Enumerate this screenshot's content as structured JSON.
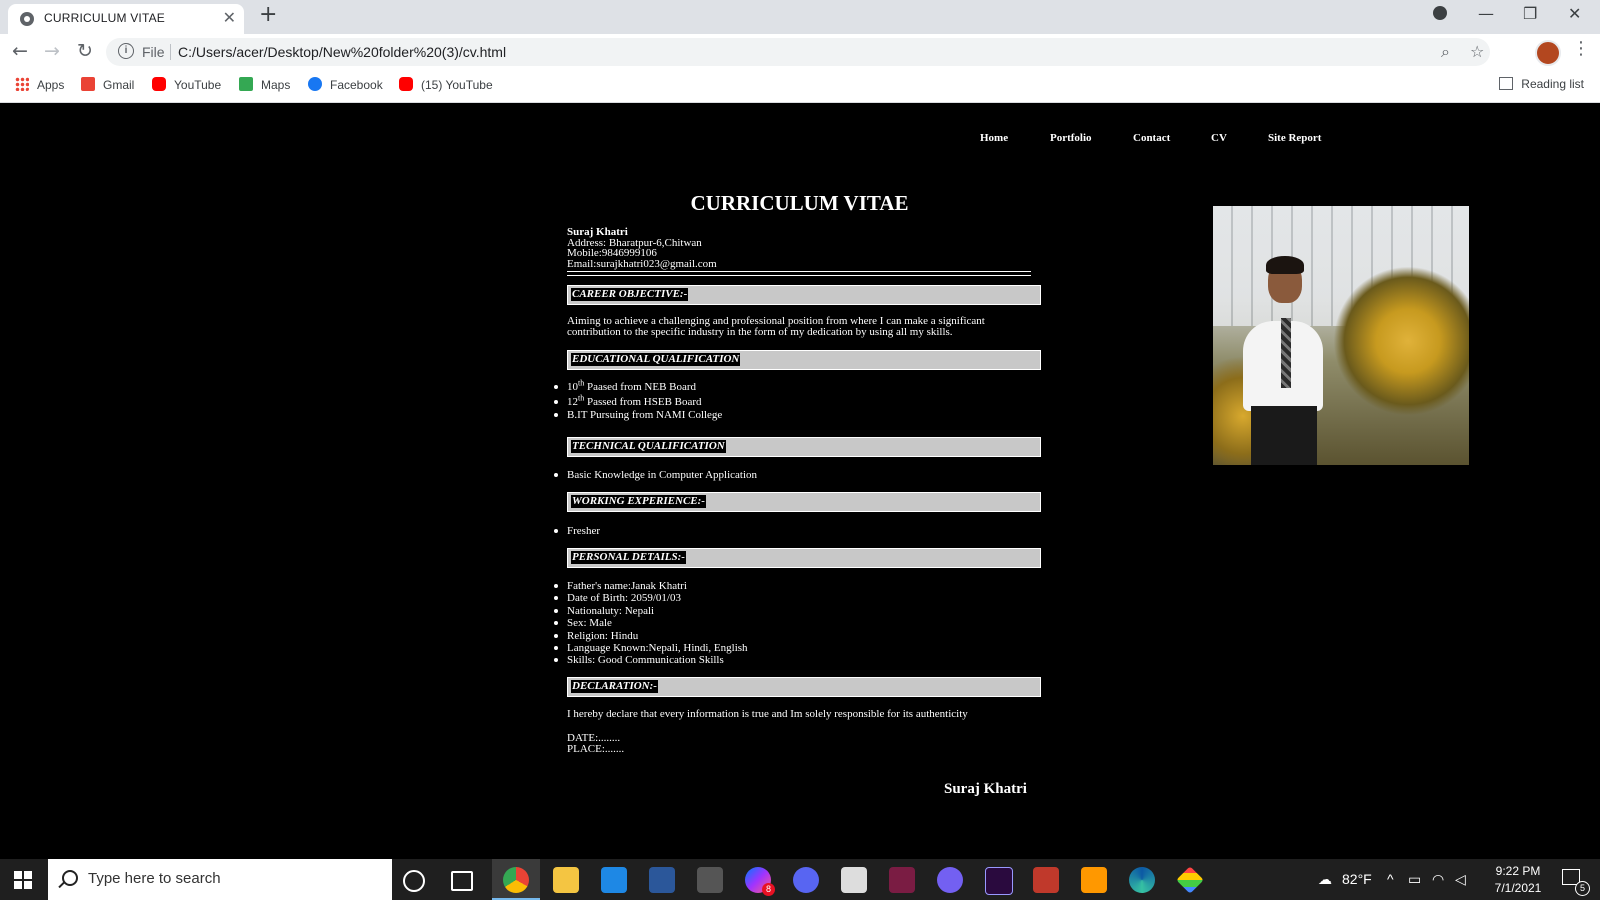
{
  "browser": {
    "tab_title": "CURRICULUM VITAE",
    "new_tab": "+",
    "close_tab": "✕",
    "window_controls": {
      "dropdown": "⌄",
      "minimize": "—",
      "restore": "❐",
      "close": "✕"
    },
    "omnibox": {
      "scheme_label": "File",
      "url": "C:/Users/acer/Desktop/New%20folder%20(3)/cv.html",
      "info_icon": "i"
    },
    "bookmarks": [
      {
        "label": "Apps",
        "icon": "apps-grid-icon",
        "color": "#ea4335"
      },
      {
        "label": "Gmail",
        "icon": "gmail-icon",
        "color": "#ea4335"
      },
      {
        "label": "YouTube",
        "icon": "youtube-icon",
        "color": "#ff0000"
      },
      {
        "label": "Maps",
        "icon": "maps-icon",
        "color": "#34a853"
      },
      {
        "label": "Facebook",
        "icon": "facebook-icon",
        "color": "#1877f2"
      },
      {
        "label": "(15) YouTube",
        "icon": "youtube-icon",
        "color": "#ff0000"
      }
    ],
    "reading_list": "Reading list"
  },
  "nav": [
    "Home",
    "Portfolio",
    "Contact",
    "CV",
    "Site Report"
  ],
  "cv": {
    "title": "CURRICULUM VITAE",
    "contact": {
      "name": "Suraj Khatri",
      "address": "Address: Bharatpur-6,Chitwan",
      "mobile": "Mobile:9846999106",
      "email": "Email:surajkhatri023@gmail.com"
    },
    "sections": {
      "career": "CAREER OBJECTIVE:-",
      "education": "EDUCATIONAL QUALIFICATION",
      "technical": "TECHNICAL QUALIFICATION",
      "experience": "WORKING EXPERIENCE:-",
      "personal": "PERSONAL DETAILS:-",
      "declaration": "DECLARATION:-"
    },
    "career_text": "Aiming to achieve a challenging and professional position from where I can make a significant contribution to the specific industry in the form of my dedication by using all my skills.",
    "education": [
      {
        "num": "10",
        "sup": "th",
        "text": " Paased from NEB Board"
      },
      {
        "num": "12",
        "sup": "th",
        "text": " Passed from HSEB Board"
      },
      {
        "num": "",
        "sup": "",
        "text": "B.IT Pursuing from NAMI College"
      }
    ],
    "technical": [
      "Basic Knowledge in Computer Application"
    ],
    "experience": [
      "Fresher"
    ],
    "personal": [
      "Father's name:Janak Khatri",
      "Date of Birth: 2059/01/03",
      "Nationaluty: Nepali",
      "Sex: Male",
      "Religion: Hindu",
      "Language Known:Nepali, Hindi, English",
      "Skills: Good Communication Skills"
    ],
    "declaration_text": "I hereby declare that every information is true and Im solely responsible for its authenticity",
    "date_label": "DATE:........",
    "place_label": "PLACE:.......",
    "signature": "Suraj Khatri"
  },
  "taskbar": {
    "search_placeholder": "Type here to search",
    "weather": "82°F",
    "time": "9:22 PM",
    "date": "7/1/2021",
    "messenger_badge": "8",
    "notification_count": "5"
  }
}
